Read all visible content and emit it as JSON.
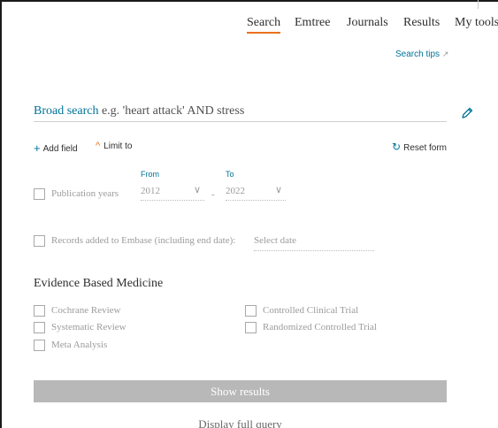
{
  "nav": {
    "items": [
      {
        "label": "Search",
        "active": true
      },
      {
        "label": "Emtree",
        "active": false
      },
      {
        "label": "Journals",
        "active": false
      },
      {
        "label": "Results",
        "active": false
      },
      {
        "label": "My tools",
        "active": false
      }
    ]
  },
  "search_tips": {
    "label": "Search tips",
    "icon": "external-link-icon",
    "glyph": "↗"
  },
  "broad_search": {
    "label": "Broad search",
    "example": " e.g. 'heart attack' AND stress",
    "icon": "pencil-icon"
  },
  "actions": {
    "add_field": "Add field",
    "add_field_glyph": "+",
    "limit_to": "Limit to",
    "limit_glyph": "^",
    "reset_form": "Reset form",
    "reset_glyph": "↻"
  },
  "publication_years": {
    "label": "Publication years",
    "from_label": "From",
    "to_label": "To",
    "from_value": "2012",
    "to_value": "2022",
    "separator": "-",
    "chevron": "∨"
  },
  "records_added": {
    "label": "Records added to Embase (including end date):",
    "placeholder": "Select date"
  },
  "ebm": {
    "title": "Evidence Based Medicine",
    "left": [
      "Cochrane Review",
      "Systematic Review",
      "Meta Analysis"
    ],
    "right": [
      "Controlled Clinical Trial",
      "Randomized Controlled Trial"
    ]
  },
  "show_results": "Show results",
  "display_full_query": "Display full query",
  "colors": {
    "accent": "#007398",
    "highlight": "#e9711c",
    "disabled_button": "#b8b8b8"
  }
}
